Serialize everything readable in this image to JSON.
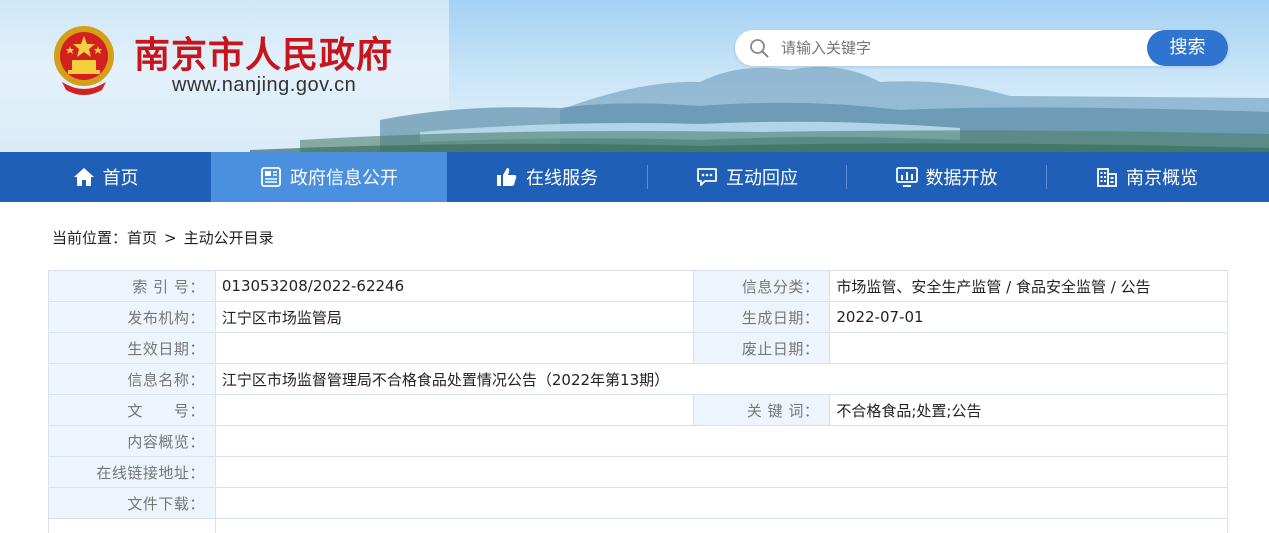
{
  "header": {
    "site_title": "南京市人民政府",
    "site_url": "www.nanjing.gov.cn",
    "search": {
      "placeholder": "请输入关键字",
      "button_label": "搜索"
    }
  },
  "nav": {
    "items": [
      {
        "label": "首页",
        "icon": "home-icon",
        "active": false
      },
      {
        "label": "政府信息公开",
        "icon": "document-icon",
        "active": true
      },
      {
        "label": "在线服务",
        "icon": "thumbs-up-icon",
        "active": false
      },
      {
        "label": "互动回应",
        "icon": "chat-icon",
        "active": false
      },
      {
        "label": "数据开放",
        "icon": "monitor-chart-icon",
        "active": false
      },
      {
        "label": "南京概览",
        "icon": "building-icon",
        "active": false
      }
    ]
  },
  "breadcrumb": {
    "prefix": "当前位置：",
    "items": [
      "首页",
      "主动公开目录"
    ],
    "separator": ">"
  },
  "info": {
    "index_no_label": "索 引 号：",
    "index_no": "013053208/2022-62246",
    "category_label": "信息分类：",
    "category": "市场监管、安全生产监管 / 食品安全监管 / 公告",
    "publisher_label": "发布机构：",
    "publisher": "江宁区市场监管局",
    "created_date_label": "生成日期：",
    "created_date": "2022-07-01",
    "effective_date_label": "生效日期：",
    "effective_date": "",
    "expiry_date_label": "废止日期：",
    "expiry_date": "",
    "name_label": "信息名称：",
    "name": "江宁区市场监督管理局不合格食品处置情况公告（2022年第13期）",
    "doc_no_label": "文　　号：",
    "doc_no": "",
    "keywords_label": "关 键 词：",
    "keywords": "不合格食品;处置;公告",
    "summary_label": "内容概览：",
    "summary": "",
    "link_label": "在线链接地址：",
    "link": "",
    "download_label": "文件下载：",
    "download": ""
  },
  "colors": {
    "title_red": "#c8141b",
    "nav_blue": "#1f5fb8",
    "nav_active": "#4b8fdf",
    "search_button": "#2f74cf",
    "label_bg": "#edf4fb"
  }
}
